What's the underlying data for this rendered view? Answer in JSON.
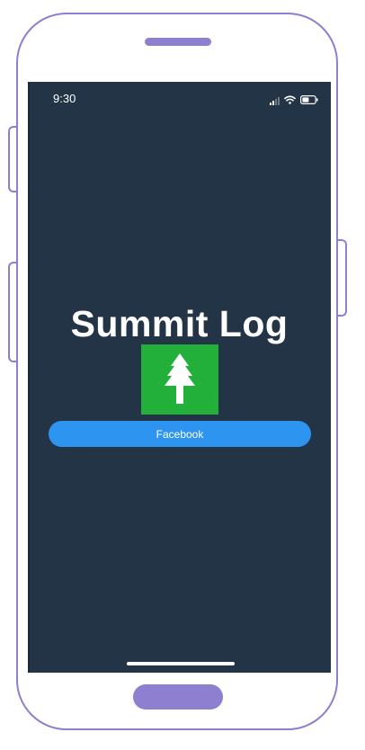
{
  "device": {
    "frame_color": "#8e7fd0",
    "screen_color": "#243447"
  },
  "status_bar": {
    "time": "9:30",
    "icons": [
      "cellular-signal-icon",
      "wifi-icon",
      "battery-icon"
    ]
  },
  "app": {
    "title": "Summit Log",
    "logo_icon": "tree-icon",
    "logo_color": "#22b03b"
  },
  "login": {
    "facebook_label": "Facebook",
    "button_color": "#2d94f0"
  }
}
